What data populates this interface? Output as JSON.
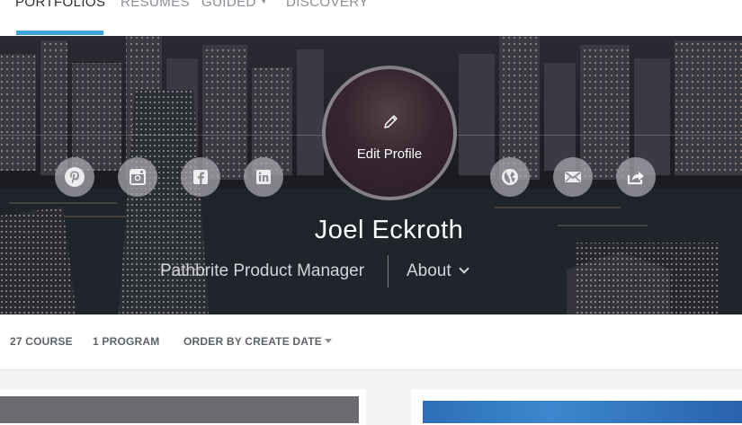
{
  "nav": {
    "items": [
      {
        "label": "PORTFOLIOS",
        "active": true
      },
      {
        "label": "RESUMES",
        "active": false
      },
      {
        "label": "GUIDED",
        "active": false,
        "has_dropdown": true
      },
      {
        "label": "DISCOVERY",
        "active": false
      }
    ],
    "accent": "#3fa2d9"
  },
  "profile": {
    "edit_label": "Edit Profile",
    "name": "Joel Eckroth",
    "title": "Pathbrite Product Manager",
    "about_label": "About"
  },
  "social_links": [
    {
      "icon": "pinterest-icon"
    },
    {
      "icon": "instagram-icon"
    },
    {
      "icon": "facebook-icon"
    },
    {
      "icon": "linkedin-icon"
    },
    {
      "icon": "globe-icon"
    },
    {
      "icon": "mail-icon"
    },
    {
      "icon": "share-icon"
    }
  ],
  "filters": {
    "courses": "27 COURSE",
    "programs": "1 PROGRAM",
    "order": "ORDER BY CREATE DATE"
  }
}
